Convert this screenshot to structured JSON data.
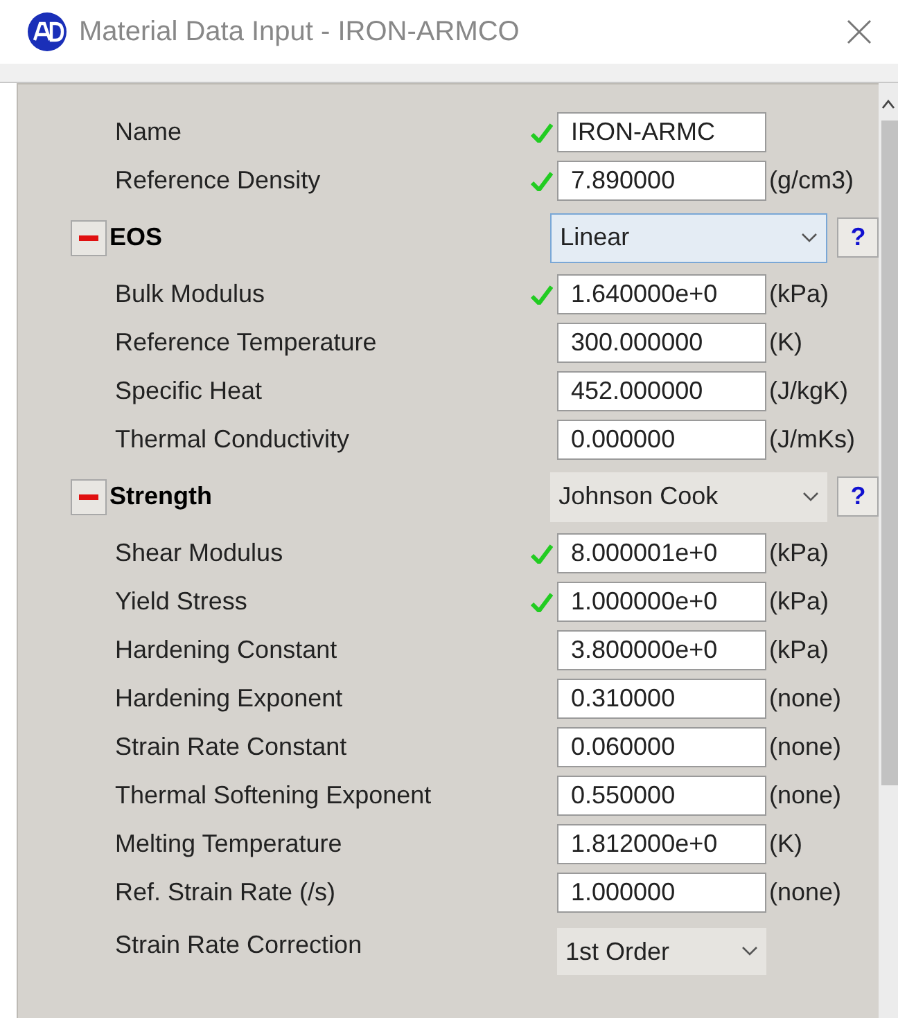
{
  "window": {
    "title": "Material Data Input - IRON-ARMCO"
  },
  "rows": [
    {
      "kind": "field",
      "label": "Name",
      "checked": true,
      "value": "IRON-ARMC"
    },
    {
      "kind": "field",
      "label": "Reference Density",
      "checked": true,
      "value": "7.890000",
      "unit": "(g/cm3)"
    },
    {
      "kind": "section",
      "label": "EOS",
      "expanded": true,
      "choice": "Linear",
      "focused": true,
      "help": "?"
    },
    {
      "kind": "field",
      "label": "Bulk Modulus",
      "checked": true,
      "value": "1.640000e+0",
      "unit": "(kPa)"
    },
    {
      "kind": "field",
      "label": "Reference Temperature",
      "checked": false,
      "value": "300.000000",
      "unit": "(K)"
    },
    {
      "kind": "field",
      "label": "Specific Heat",
      "checked": false,
      "value": "452.000000",
      "unit": "(J/kgK)"
    },
    {
      "kind": "field",
      "label": "Thermal Conductivity",
      "checked": false,
      "value": "0.000000",
      "unit": "(J/mKs)"
    },
    {
      "kind": "section",
      "label": "Strength",
      "expanded": true,
      "choice": "Johnson Cook",
      "focused": false,
      "help": "?"
    },
    {
      "kind": "field",
      "label": "Shear Modulus",
      "checked": true,
      "value": "8.000001e+0",
      "unit": "(kPa)"
    },
    {
      "kind": "field",
      "label": "Yield Stress",
      "checked": true,
      "value": "1.000000e+0",
      "unit": "(kPa)"
    },
    {
      "kind": "field",
      "label": "Hardening Constant",
      "checked": false,
      "value": "3.800000e+0",
      "unit": "(kPa)"
    },
    {
      "kind": "field",
      "label": "Hardening Exponent",
      "checked": false,
      "value": "0.310000",
      "unit": "(none)"
    },
    {
      "kind": "field",
      "label": "Strain Rate Constant",
      "checked": false,
      "value": "0.060000",
      "unit": "(none)"
    },
    {
      "kind": "field",
      "label": "Thermal Softening Exponent",
      "checked": false,
      "value": "0.550000",
      "unit": "(none)"
    },
    {
      "kind": "field",
      "label": "Melting Temperature",
      "checked": false,
      "value": "1.812000e+0",
      "unit": "(K)"
    },
    {
      "kind": "field",
      "label": "Ref. Strain Rate (/s)",
      "checked": false,
      "value": "1.000000",
      "unit": "(none)"
    },
    {
      "kind": "select",
      "label": "Strain Rate Correction",
      "choice": "1st Order"
    }
  ]
}
